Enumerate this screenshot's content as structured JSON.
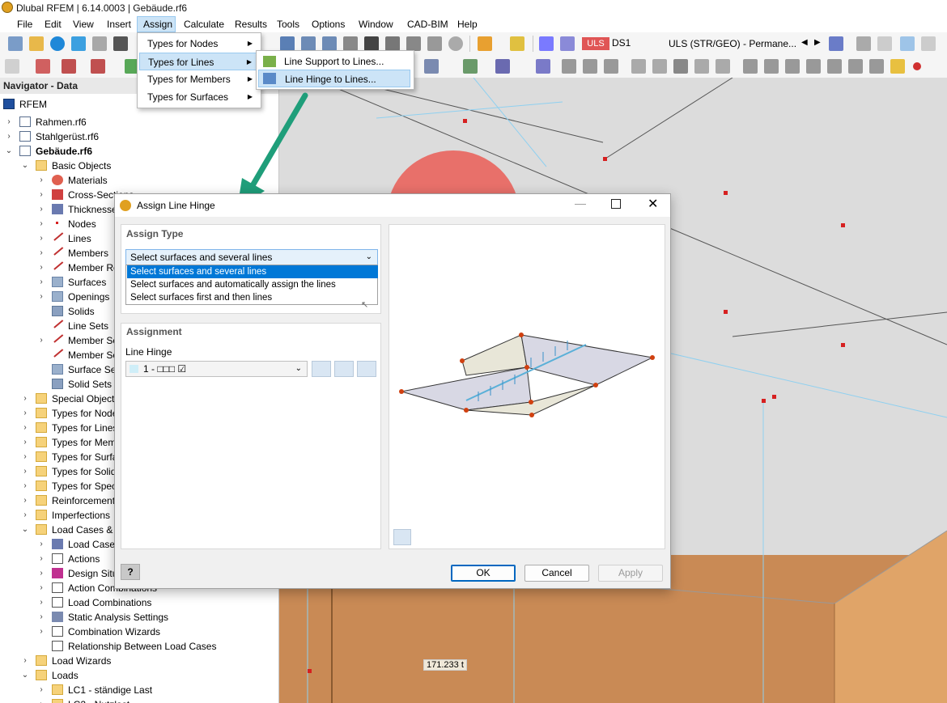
{
  "window": {
    "title": "Dlubal RFEM | 6.14.0003 | Gebäude.rf6"
  },
  "menubar": [
    "File",
    "Edit",
    "View",
    "Insert",
    "Assign",
    "Calculate",
    "Results",
    "Tools",
    "Options",
    "Window",
    "CAD-BIM",
    "Help"
  ],
  "toolbar": {
    "load_badge": "ULS",
    "load_id": "DS1",
    "load_combo": "ULS (STR/GEO) - Permane..."
  },
  "assign_menu": [
    "Types for Nodes",
    "Types for Lines",
    "Types for Members",
    "Types for Surfaces"
  ],
  "lines_submenu": [
    "Line Support to Lines...",
    "Line Hinge to Lines..."
  ],
  "navigator": {
    "title": "Navigator - Data",
    "root": "RFEM",
    "items": [
      {
        "label": "Rahmen.rf6"
      },
      {
        "label": "Stahlgerüst.rf6"
      },
      {
        "label": "Gebäude.rf6"
      },
      {
        "label": "Basic Objects"
      },
      {
        "label": "Materials"
      },
      {
        "label": "Cross-Sections"
      },
      {
        "label": "Thicknesses"
      },
      {
        "label": "Nodes"
      },
      {
        "label": "Lines"
      },
      {
        "label": "Members"
      },
      {
        "label": "Member Re"
      },
      {
        "label": "Surfaces"
      },
      {
        "label": "Openings"
      },
      {
        "label": "Solids"
      },
      {
        "label": "Line Sets"
      },
      {
        "label": "Member Se"
      },
      {
        "label": "Member Se"
      },
      {
        "label": "Surface Set"
      },
      {
        "label": "Solid Sets"
      },
      {
        "label": "Special Objects"
      },
      {
        "label": "Types for Node"
      },
      {
        "label": "Types for Lines"
      },
      {
        "label": "Types for Memb"
      },
      {
        "label": "Types for Surfa"
      },
      {
        "label": "Types for Solids"
      },
      {
        "label": "Types for Speci"
      },
      {
        "label": "Reinforcement"
      },
      {
        "label": "Imperfections"
      },
      {
        "label": "Load Cases & C"
      },
      {
        "label": "Load Cases"
      },
      {
        "label": "Actions"
      },
      {
        "label": "Design Situ"
      },
      {
        "label": "Action Combinations"
      },
      {
        "label": "Load Combinations"
      },
      {
        "label": "Static Analysis Settings"
      },
      {
        "label": "Combination Wizards"
      },
      {
        "label": "Relationship Between Load Cases"
      },
      {
        "label": "Load Wizards"
      },
      {
        "label": "Loads"
      },
      {
        "label": "LC1 - ständige Last"
      },
      {
        "label": "LC2 - Nutzlast"
      }
    ]
  },
  "dialog": {
    "title": "Assign Line Hinge",
    "assign_type": {
      "heading": "Assign Type",
      "selected": "Select surfaces and several lines",
      "options": [
        "Select surfaces and several lines",
        "Select surfaces and automatically assign the lines",
        "Select surfaces first and then lines"
      ]
    },
    "assignment": {
      "heading": "Assignment",
      "hinge_label": "Line Hinge",
      "hinge_value": "1 - □□□ ☑"
    },
    "buttons": {
      "ok": "OK",
      "cancel": "Cancel",
      "apply": "Apply"
    }
  },
  "viewport": {
    "load_value_label": "171.233 t"
  },
  "colors": {
    "accent": "#0078d7",
    "highlight": "#cce4f7",
    "arrow": "#1f9e7a",
    "sphere": "#e8706a",
    "wall": "#c98a55",
    "node": "#d62020"
  }
}
